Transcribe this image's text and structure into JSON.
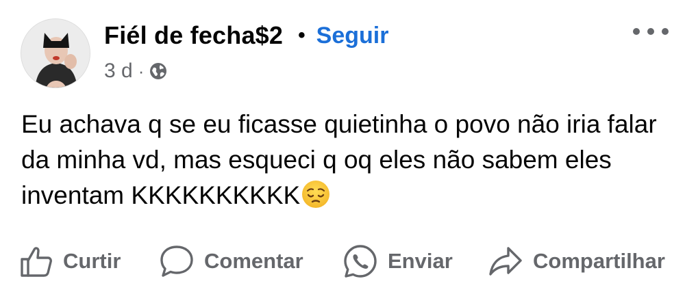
{
  "post": {
    "author_name": "Fiél de fecha$2",
    "separator": "•",
    "follow_label": "Seguir",
    "time_ago": "3 d",
    "meta_separator": "·",
    "privacy_icon": "globe-icon",
    "more_icon": "more-options-icon",
    "text": "Eu achava q se eu ficasse quietinha o povo não iria falar da minha vd, mas esqueci q oq eles não sabem eles inventam KKKKKKKKKK",
    "emoji": "pensive-face-emoji"
  },
  "actions": [
    {
      "label": "Curtir",
      "icon": "like-thumb-icon"
    },
    {
      "label": "Comentar",
      "icon": "comment-bubble-icon"
    },
    {
      "label": "Enviar",
      "icon": "whatsapp-send-icon"
    },
    {
      "label": "Compartilhar",
      "icon": "share-arrow-icon"
    }
  ],
  "colors": {
    "link": "#1b6fd8",
    "secondary_text": "#65676b",
    "primary_text": "#050505"
  }
}
